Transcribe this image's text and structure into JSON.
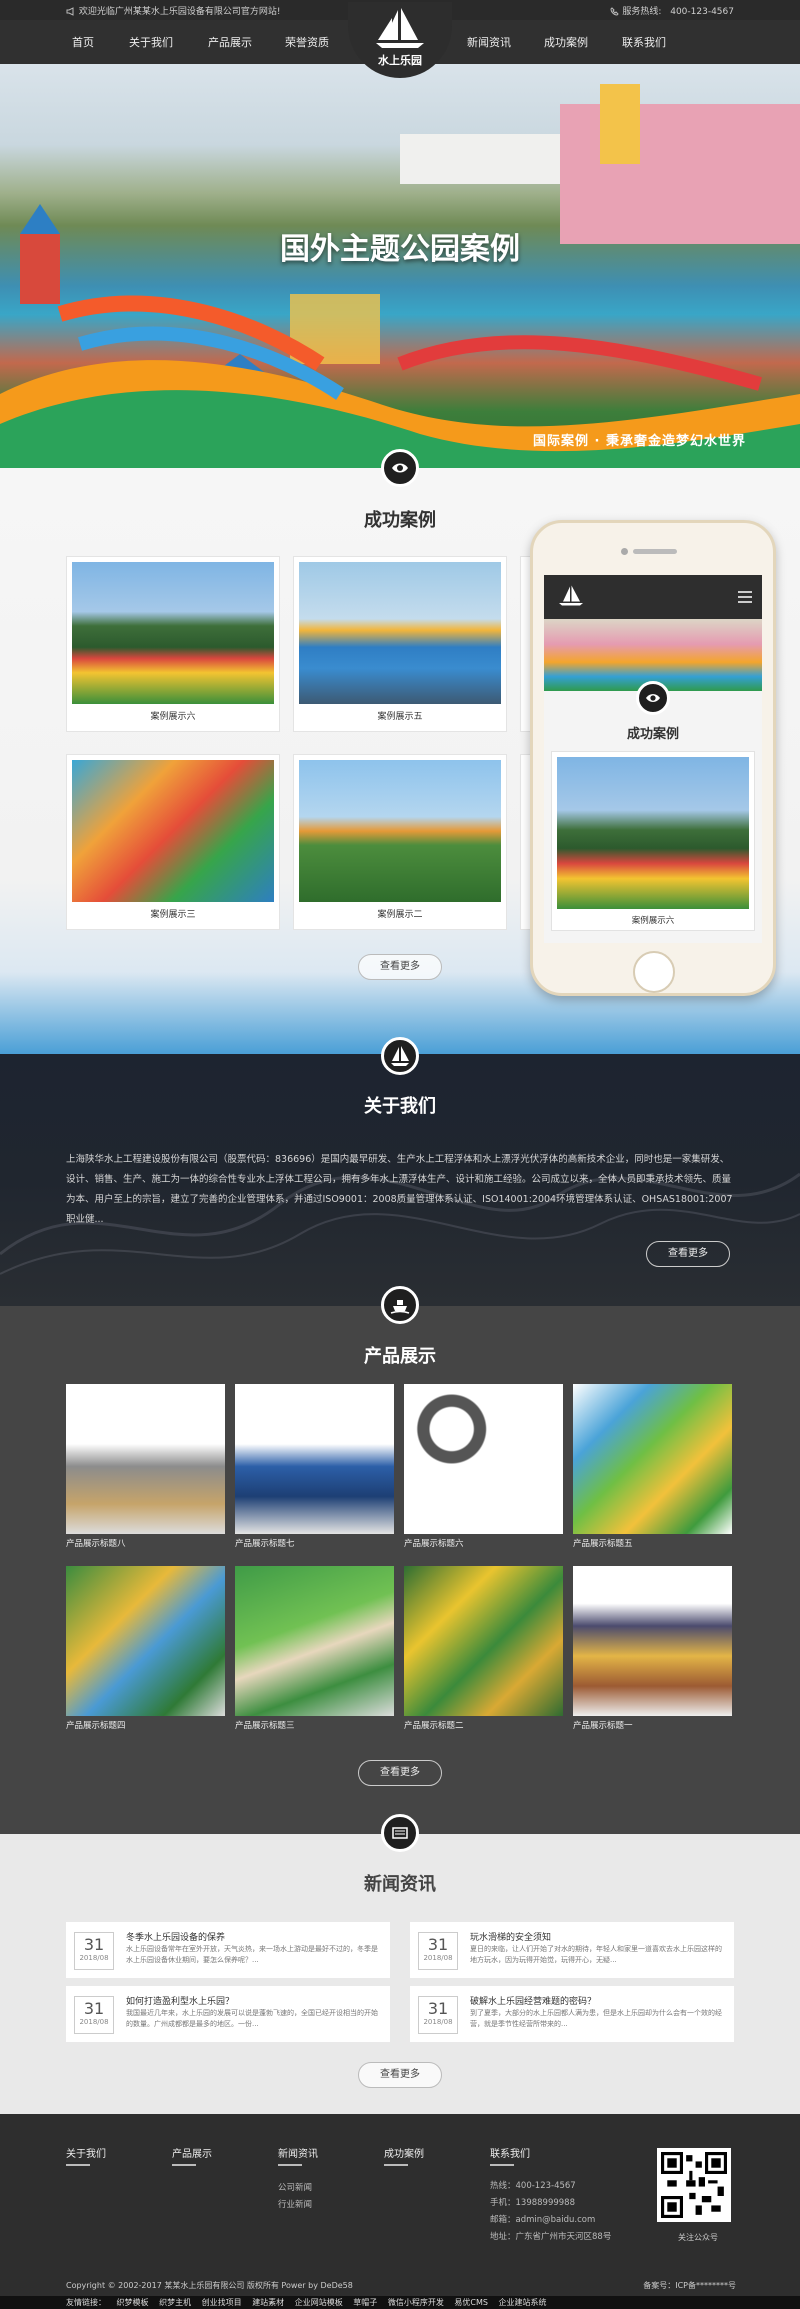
{
  "topbar": {
    "welcome": "欢迎光临广州某某水上乐园设备有限公司官方网站!",
    "hotline_label": "服务热线:",
    "hotline": "400-123-4567"
  },
  "nav": {
    "left": [
      "首页",
      "关于我们",
      "产品展示",
      "荣誉资质"
    ],
    "right": [
      "新闻资讯",
      "成功案例",
      "联系我们"
    ],
    "logo_text": "水上乐园"
  },
  "banner": {
    "title": "国外主题公园案例",
    "subtitle": "国际案例 · 秉承奢金造梦幻水世界"
  },
  "cases": {
    "title": "成功案例",
    "items": [
      "案例展示六",
      "案例展示五",
      "案例展示三",
      "案例展示二"
    ],
    "more": "查看更多"
  },
  "phone": {
    "title": "成功案例",
    "item": "案例展示六"
  },
  "about": {
    "title": "关于我们",
    "text": "上海陕华水上工程建设股份有限公司（股票代码：836696）是国内最早研发、生产水上工程浮体和水上漂浮光伏浮体的高新技术企业，同时也是一家集研发、设计、销售、生产、施工为一体的综合性专业水上浮体工程公司，拥有多年水上漂浮体生产、设计和施工经验。公司成立以来，全体人员即秉承技术领先、质量为本、用户至上的宗旨，建立了完善的企业管理体系，并通过ISO9001：2008质量管理体系认证、ISO14001:2004环境管理体系认证、OHSAS18001:2007职业健...",
    "more": "查看更多"
  },
  "products": {
    "title": "产品展示",
    "items": [
      "产品展示标题八",
      "产品展示标题七",
      "产品展示标题六",
      "产品展示标题五",
      "产品展示标题四",
      "产品展示标题三",
      "产品展示标题二",
      "产品展示标题一"
    ],
    "more": "查看更多"
  },
  "news": {
    "title": "新闻资讯",
    "items": [
      {
        "day": "31",
        "ym": "2018/08",
        "title": "冬季水上乐园设备的保养",
        "desc": "水上乐园设备常年在室外开放，天气炎热，来一场水上游动是最好不过的，冬季是水上乐园设备休业期间，要怎么保养呢？..."
      },
      {
        "day": "31",
        "ym": "2018/08",
        "title": "玩水滑梯的安全须知",
        "desc": "夏日的来临，让人们开始了对水的期待，年轻人和家里一道喜欢去水上乐园这样的地方玩水，因为玩得开始觉，玩得开心，无疑..."
      },
      {
        "day": "31",
        "ym": "2018/08",
        "title": "如何打造盈利型水上乐园？",
        "desc": "我国最近几年来，水上乐园的发展可以说是蓬勃飞速的，全国已经开设相当的开始的数量。广州成都都是最多的地区。一份..."
      },
      {
        "day": "31",
        "ym": "2018/08",
        "title": "破解水上乐园经营难题的密码？",
        "desc": "到了夏季，大部分的水上乐园都人满为患，但是水上乐园却为什么会有一个效的经营，就是季节性经营所带来的..."
      }
    ],
    "more": "查看更多"
  },
  "footer": {
    "cols": [
      "关于我们",
      "产品展示",
      "新闻资讯",
      "成功案例",
      "联系我们"
    ],
    "news_links": [
      "公司新闻",
      "行业新闻"
    ],
    "contact": [
      "热线：400-123-4567",
      "手机：13988999988",
      "邮箱：admin@baidu.com",
      "地址：广东省广州市天河区88号"
    ],
    "qr_label": "关注公众号",
    "copyright": "Copyright © 2002-2017 某某水上乐园有限公司 版权所有 Power by DeDe58",
    "icp": "备案号：ICP备********号",
    "links_label": "友情链接：",
    "links": [
      "织梦模板",
      "织梦主机",
      "创业找项目",
      "建站素材",
      "企业网站模板",
      "草帽子",
      "微信小程序开发",
      "易优CMS",
      "企业建站系统"
    ]
  }
}
